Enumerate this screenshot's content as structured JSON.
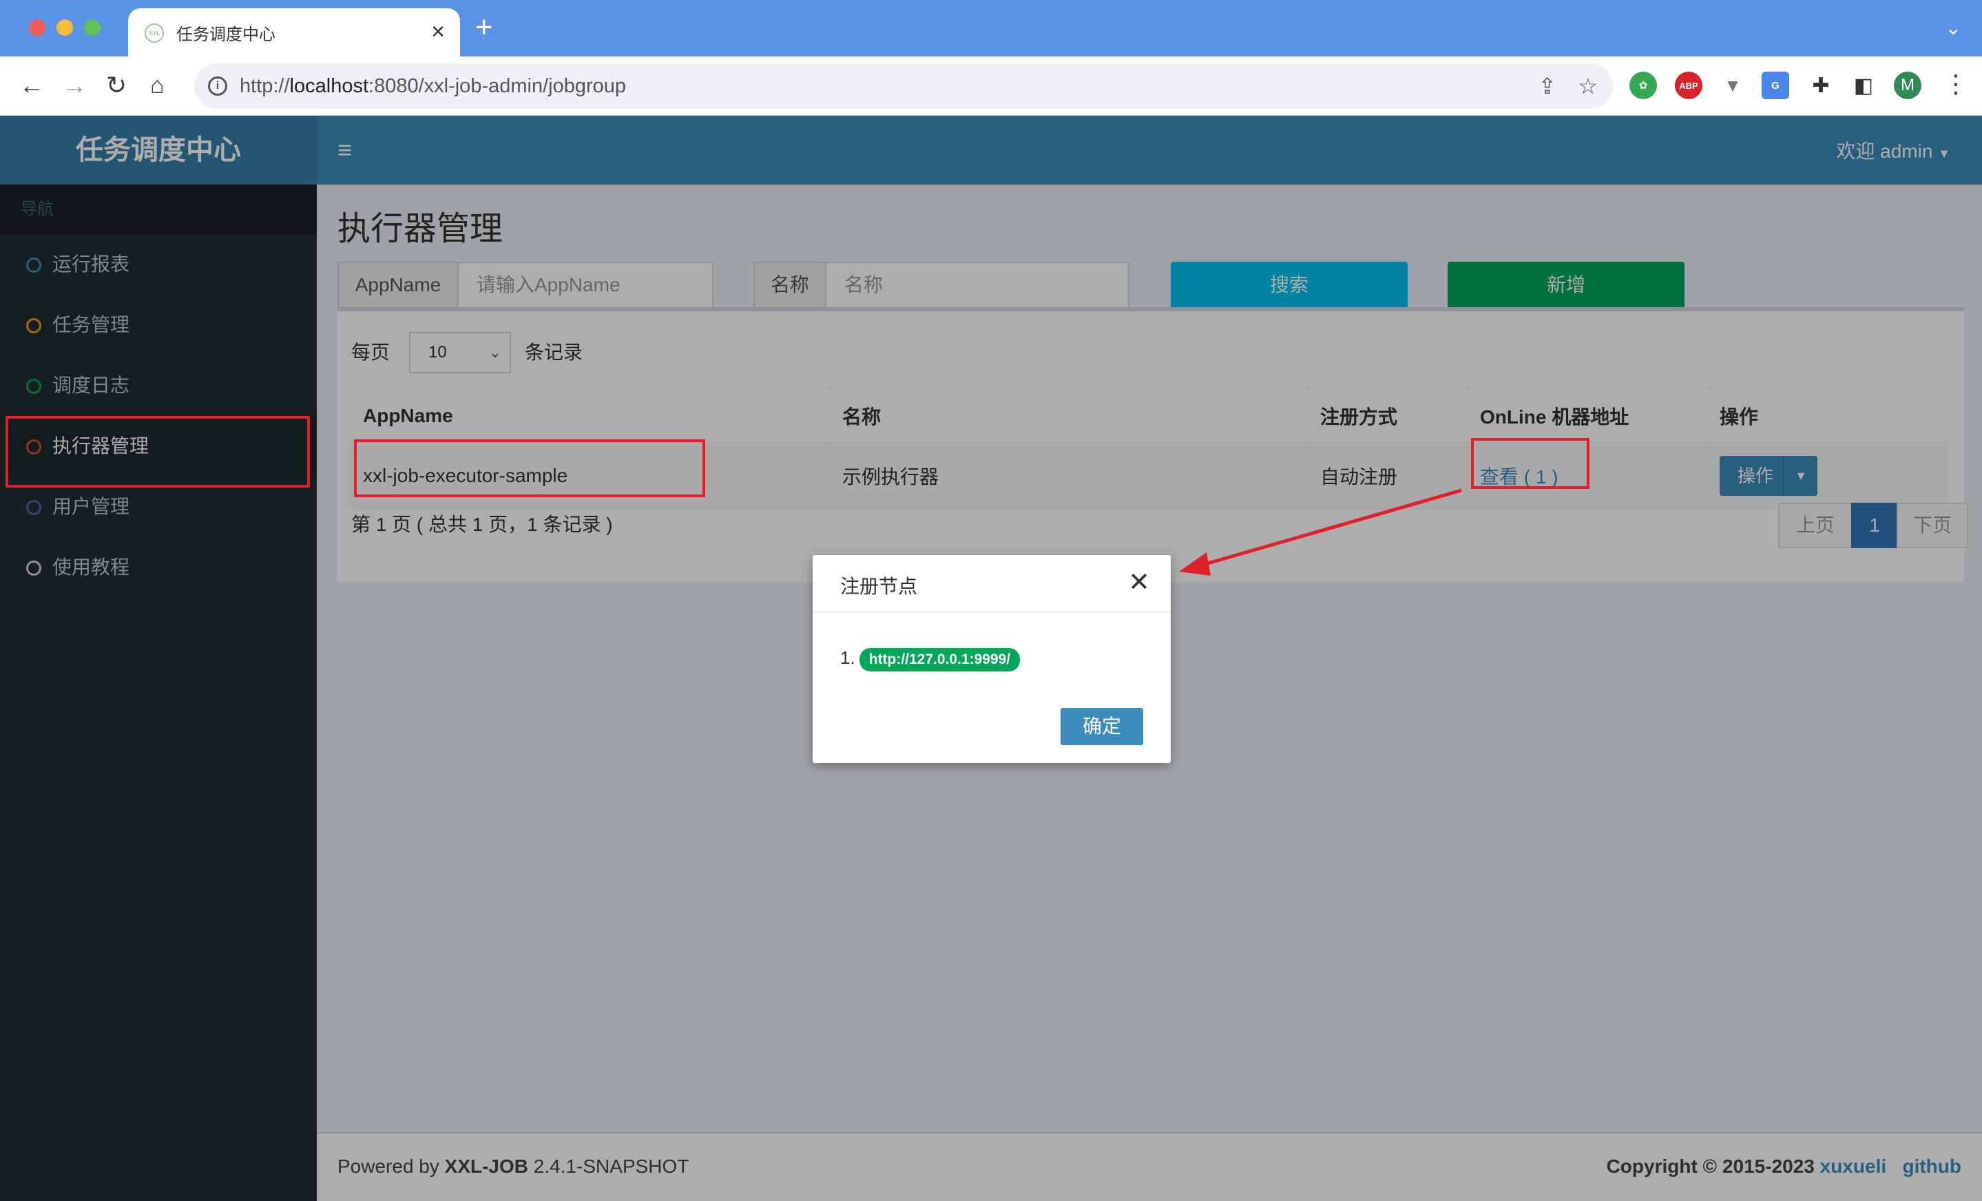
{
  "browser": {
    "tab_title": "任务调度中心",
    "tab_favicon": "XXL",
    "url_prefix": "http://",
    "url_host": "localhost",
    "url_rest": ":8080/xxl-job-admin/jobgroup",
    "profile_initial": "M",
    "ext_abp": "ABP"
  },
  "app": {
    "logo": "任务调度中心",
    "nav_header": "导航",
    "menu": [
      {
        "label": "运行报表",
        "color": "#3c8dbc"
      },
      {
        "label": "任务管理",
        "color": "#f39c12"
      },
      {
        "label": "调度日志",
        "color": "#00a65a"
      },
      {
        "label": "执行器管理",
        "color": "#dd4b39"
      },
      {
        "label": "用户管理",
        "color": "#605ca8"
      },
      {
        "label": "使用教程",
        "color": "#d2d6de"
      }
    ],
    "user_menu": "欢迎 admin"
  },
  "page": {
    "title": "执行器管理",
    "filter": {
      "appname_label": "AppName",
      "appname_placeholder": "请输入AppName",
      "name_label": "名称",
      "name_placeholder": "名称",
      "search_btn": "搜索",
      "add_btn": "新增"
    },
    "perpage_prefix": "每页",
    "perpage_value": "10",
    "perpage_suffix": "条记录",
    "table": {
      "headers": [
        "AppName",
        "名称",
        "注册方式",
        "OnLine 机器地址",
        "操作"
      ],
      "rows": [
        {
          "appname": "xxl-job-executor-sample",
          "name": "示例执行器",
          "reg_type": "自动注册",
          "online": "查看 ( 1 )",
          "action": "操作"
        }
      ]
    },
    "page_info": "第 1 页 ( 总共 1 页，1 条记录 )",
    "pagination": {
      "prev": "上页",
      "current": "1",
      "next": "下页"
    }
  },
  "footer": {
    "powered_prefix": "Powered by ",
    "powered_brand": "XXL-JOB",
    "powered_version": " 2.4.1-SNAPSHOT",
    "copyright": "Copyright © 2015-2023 ",
    "author": "xuxueli",
    "github": "github"
  },
  "modal": {
    "title": "注册节点",
    "item_index": "1.",
    "address": "http://127.0.0.1:9999/",
    "confirm": "确定"
  }
}
